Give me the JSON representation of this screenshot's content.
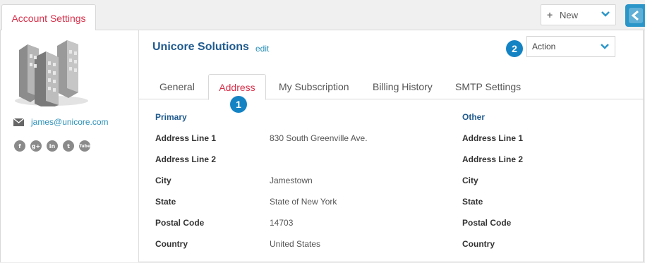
{
  "page_tab": "Account Settings",
  "toolbar": {
    "new_label": "New"
  },
  "sidebar": {
    "email": "james@unicore.com",
    "social": [
      {
        "name": "facebook-icon",
        "glyph": "f"
      },
      {
        "name": "google-plus-icon",
        "glyph": "g+"
      },
      {
        "name": "linkedin-icon",
        "glyph": "in"
      },
      {
        "name": "twitter-icon",
        "glyph": "t"
      },
      {
        "name": "youtube-icon",
        "glyph": "Tube"
      }
    ]
  },
  "header": {
    "company": "Unicore Solutions",
    "edit": "edit",
    "action_select": "Action"
  },
  "badges": {
    "one": "1",
    "two": "2"
  },
  "tabs": [
    "General",
    "Address",
    "My Subscription",
    "Billing History",
    "SMTP Settings"
  ],
  "address": {
    "primary_title": "Primary",
    "other_title": "Other",
    "rows": [
      {
        "label": "Address Line 1",
        "value": "830 South Greenville Ave.",
        "other_label": "Address Line 1"
      },
      {
        "label": "Address Line 2",
        "value": "",
        "other_label": "Address Line 2"
      },
      {
        "label": "City",
        "value": "Jamestown",
        "other_label": "City"
      },
      {
        "label": "State",
        "value": "State of New York",
        "other_label": "State"
      },
      {
        "label": "Postal Code",
        "value": "14703",
        "other_label": "Postal Code"
      },
      {
        "label": "Country",
        "value": "United States",
        "other_label": "Country"
      }
    ]
  },
  "colors": {
    "accent_red": "#d7304a",
    "link_blue": "#2a8fb8",
    "title_blue": "#1f5a8e",
    "badge_blue": "#1483c4"
  }
}
